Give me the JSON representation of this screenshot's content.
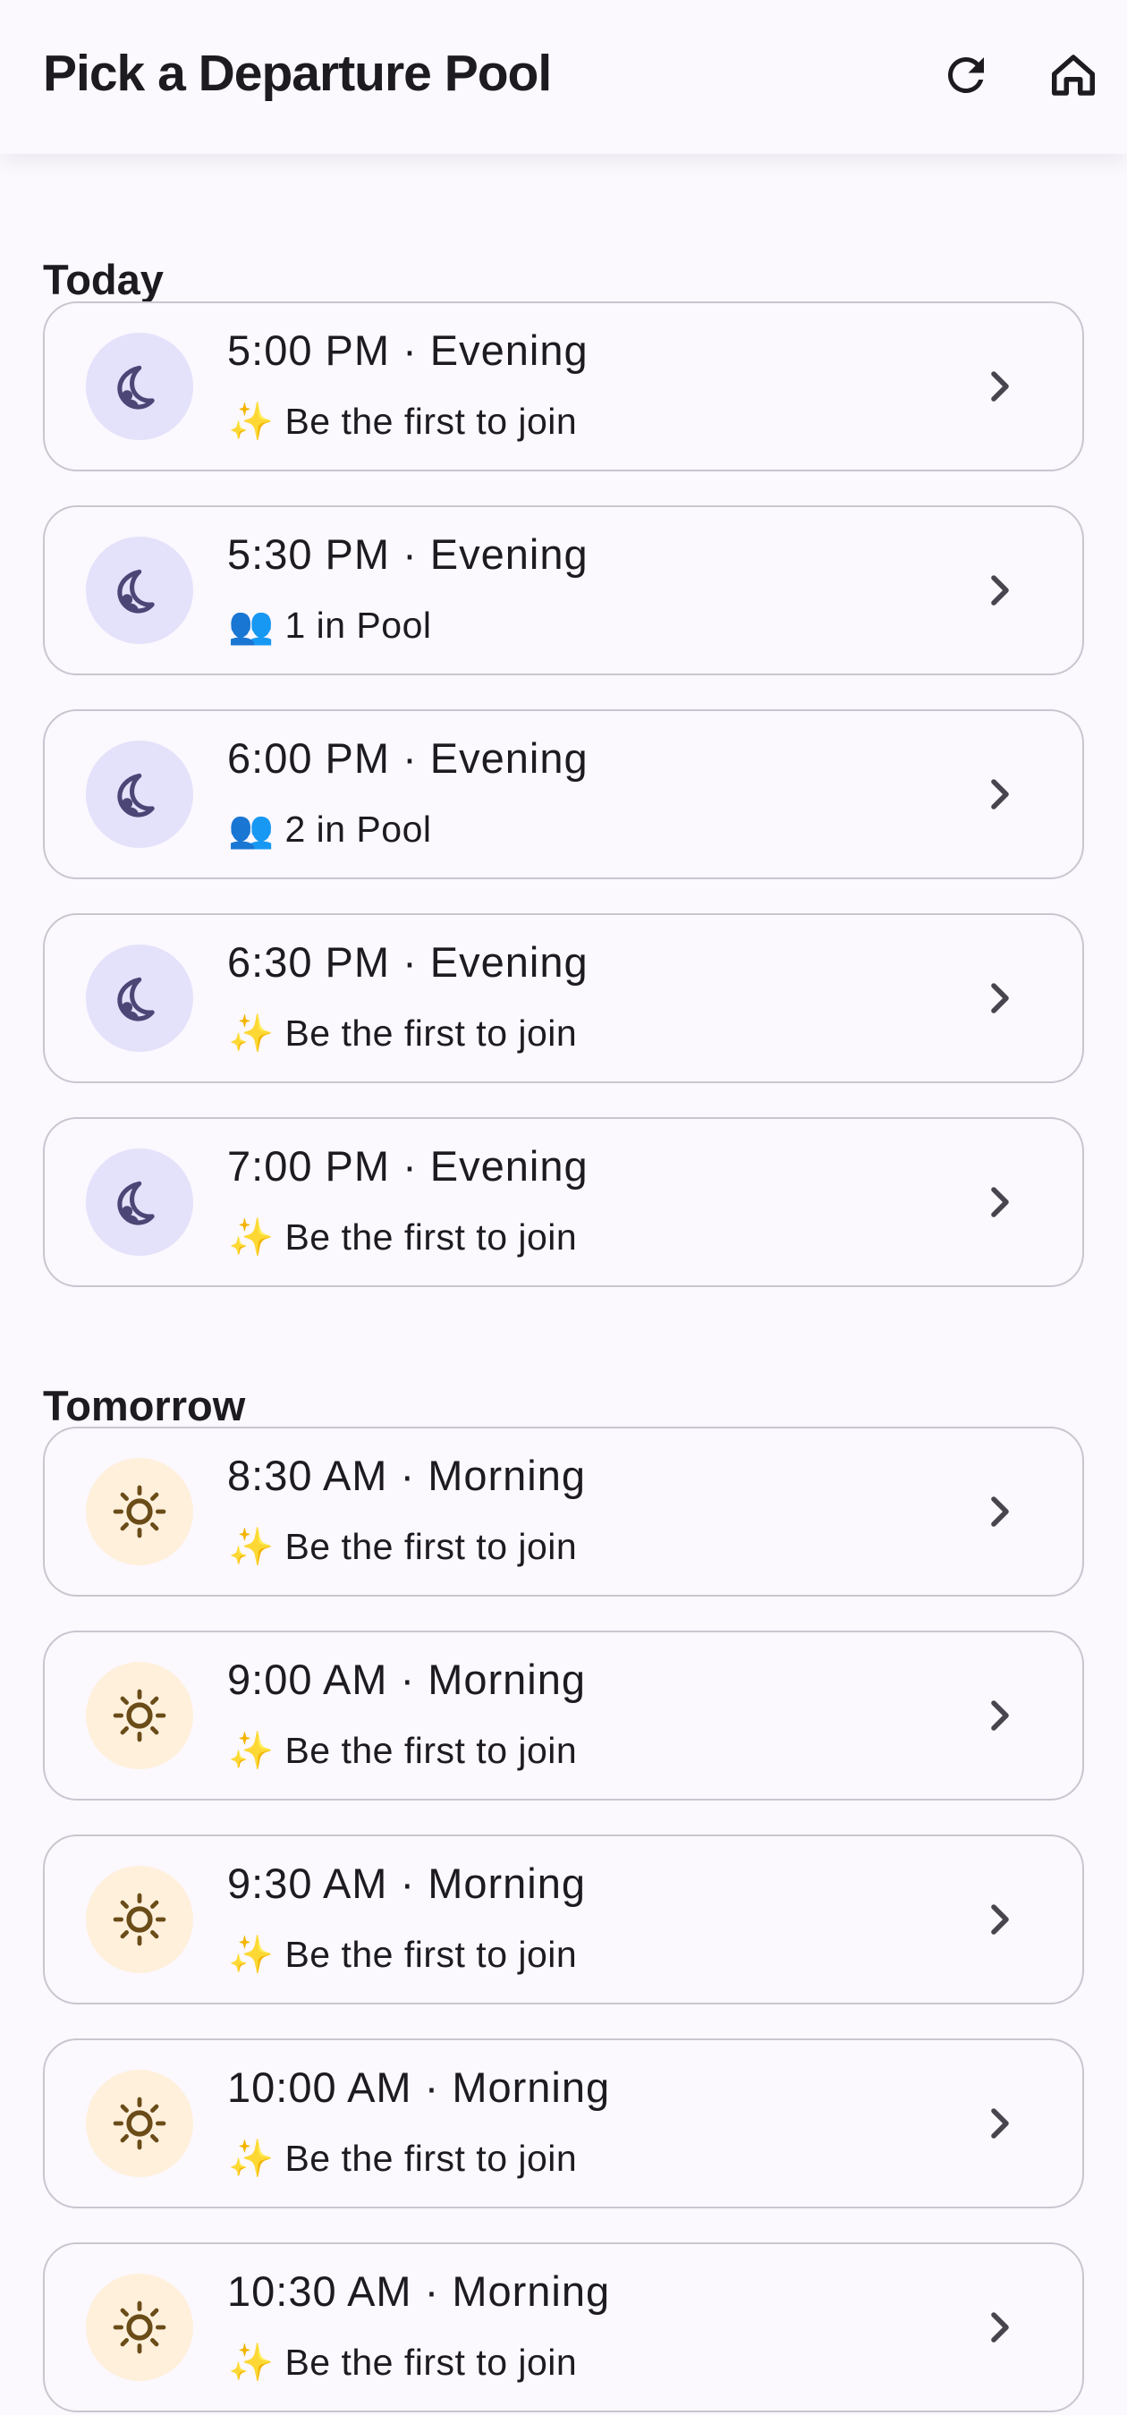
{
  "app_bar": {
    "title": "Pick a Departure Pool",
    "refresh_icon": "refresh-icon",
    "home_icon": "home-icon"
  },
  "colors": {
    "background": "#fbf8fe",
    "border": "#cac6d0",
    "evening_icon_bg": "#e4e1fb",
    "evening_icon": "#4c4676",
    "morning_icon_bg": "#fff0dc",
    "morning_icon": "#6a4c18",
    "text": "#1d1b20"
  },
  "sections": {
    "today": {
      "title": "Today",
      "pools": [
        {
          "time_label": "5:00 PM · Evening",
          "status_label": "✨ Be the first to join",
          "icon": "moon-icon",
          "action_icon": "chevron-right-icon"
        },
        {
          "time_label": "5:30 PM · Evening",
          "status_label": "👥 1 in Pool",
          "icon": "moon-icon",
          "action_icon": "chevron-right-icon"
        },
        {
          "time_label": "6:00 PM · Evening",
          "status_label": "👥 2 in Pool",
          "icon": "moon-icon",
          "action_icon": "chevron-right-icon"
        },
        {
          "time_label": "6:30 PM · Evening",
          "status_label": "✨ Be the first to join",
          "icon": "moon-icon",
          "action_icon": "chevron-right-icon"
        },
        {
          "time_label": "7:00 PM · Evening",
          "status_label": "✨ Be the first to join",
          "icon": "moon-icon",
          "action_icon": "chevron-right-icon"
        }
      ]
    },
    "tomorrow": {
      "title": "Tomorrow",
      "pools": [
        {
          "time_label": "8:30 AM · Morning",
          "status_label": "✨ Be the first to join",
          "icon": "sun-icon",
          "action_icon": "chevron-right-icon"
        },
        {
          "time_label": "9:00 AM · Morning",
          "status_label": "✨ Be the first to join",
          "icon": "sun-icon",
          "action_icon": "chevron-right-icon"
        },
        {
          "time_label": "9:30 AM · Morning",
          "status_label": "✨ Be the first to join",
          "icon": "sun-icon",
          "action_icon": "chevron-right-icon"
        },
        {
          "time_label": "10:00 AM · Morning",
          "status_label": "✨ Be the first to join",
          "icon": "sun-icon",
          "action_icon": "chevron-right-icon"
        },
        {
          "time_label": "10:30 AM · Morning",
          "status_label": "✨ Be the first to join",
          "icon": "sun-icon",
          "action_icon": "chevron-right-icon"
        }
      ]
    }
  }
}
